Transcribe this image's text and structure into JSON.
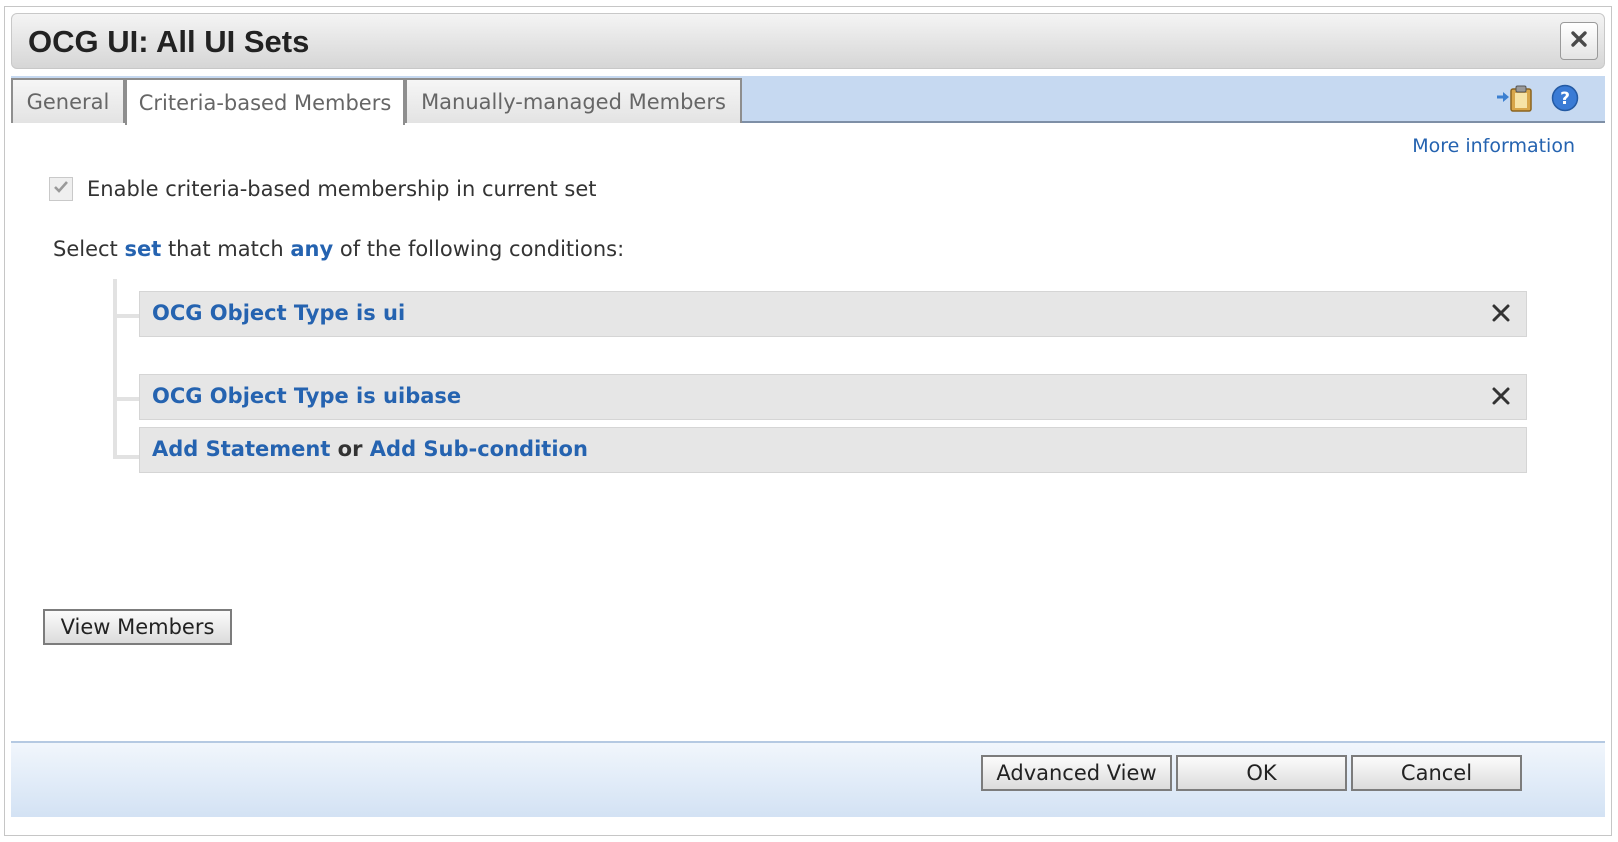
{
  "dialog": {
    "title": "OCG UI: All UI Sets",
    "close_icon": "close-icon"
  },
  "tabs": [
    {
      "label": "General",
      "active": false
    },
    {
      "label": "Criteria-based Members",
      "active": true
    },
    {
      "label": "Manually-managed Members",
      "active": false
    }
  ],
  "tab_tools": {
    "paste_icon": "paste-clipboard-icon",
    "help_icon": "help-icon"
  },
  "more_info": "More information",
  "enable": {
    "checked": true,
    "label": "Enable criteria-based membership in current set"
  },
  "select_line": {
    "prefix": "Select",
    "target": "set",
    "middle": "that match",
    "quantifier": "any",
    "suffix": "of the following conditions:"
  },
  "conditions": [
    {
      "text": "OCG Object Type is ui"
    },
    {
      "text": "OCG Object Type is uibase"
    }
  ],
  "add_row": {
    "add_statement": "Add Statement",
    "or": "or",
    "add_subcondition": "Add Sub-condition"
  },
  "view_members": "View Members",
  "footer": {
    "advanced_view": "Advanced View",
    "ok": "OK",
    "cancel": "Cancel"
  },
  "colors": {
    "link": "#2563b0",
    "tab_strip": "#c6d9f1",
    "footer": "#d3e2f4"
  }
}
